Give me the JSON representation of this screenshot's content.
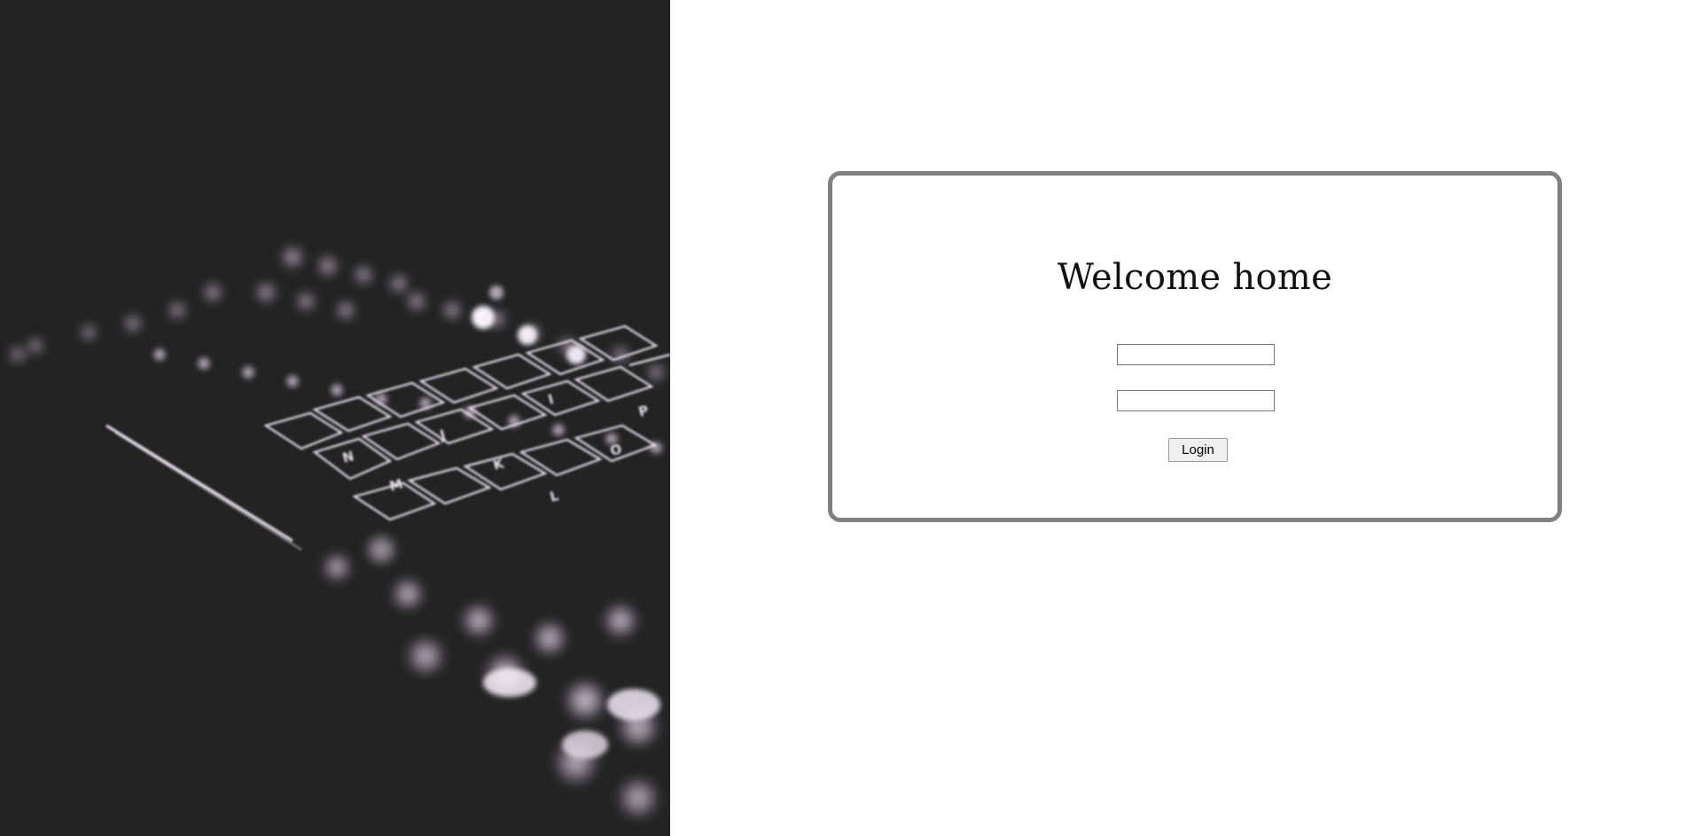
{
  "hero": {
    "image": "backlit-keyboard-photo",
    "colors": {
      "background": "#232323",
      "glow": "#e8dff0",
      "bokeh": "#b7a7bf"
    },
    "keycaps": [
      "N",
      "M",
      "J",
      "K",
      "I",
      "O",
      "P",
      "L"
    ]
  },
  "login": {
    "title": "Welcome home",
    "username_value": "",
    "password_value": "",
    "button_label": "Login",
    "border_color": "#808080"
  }
}
